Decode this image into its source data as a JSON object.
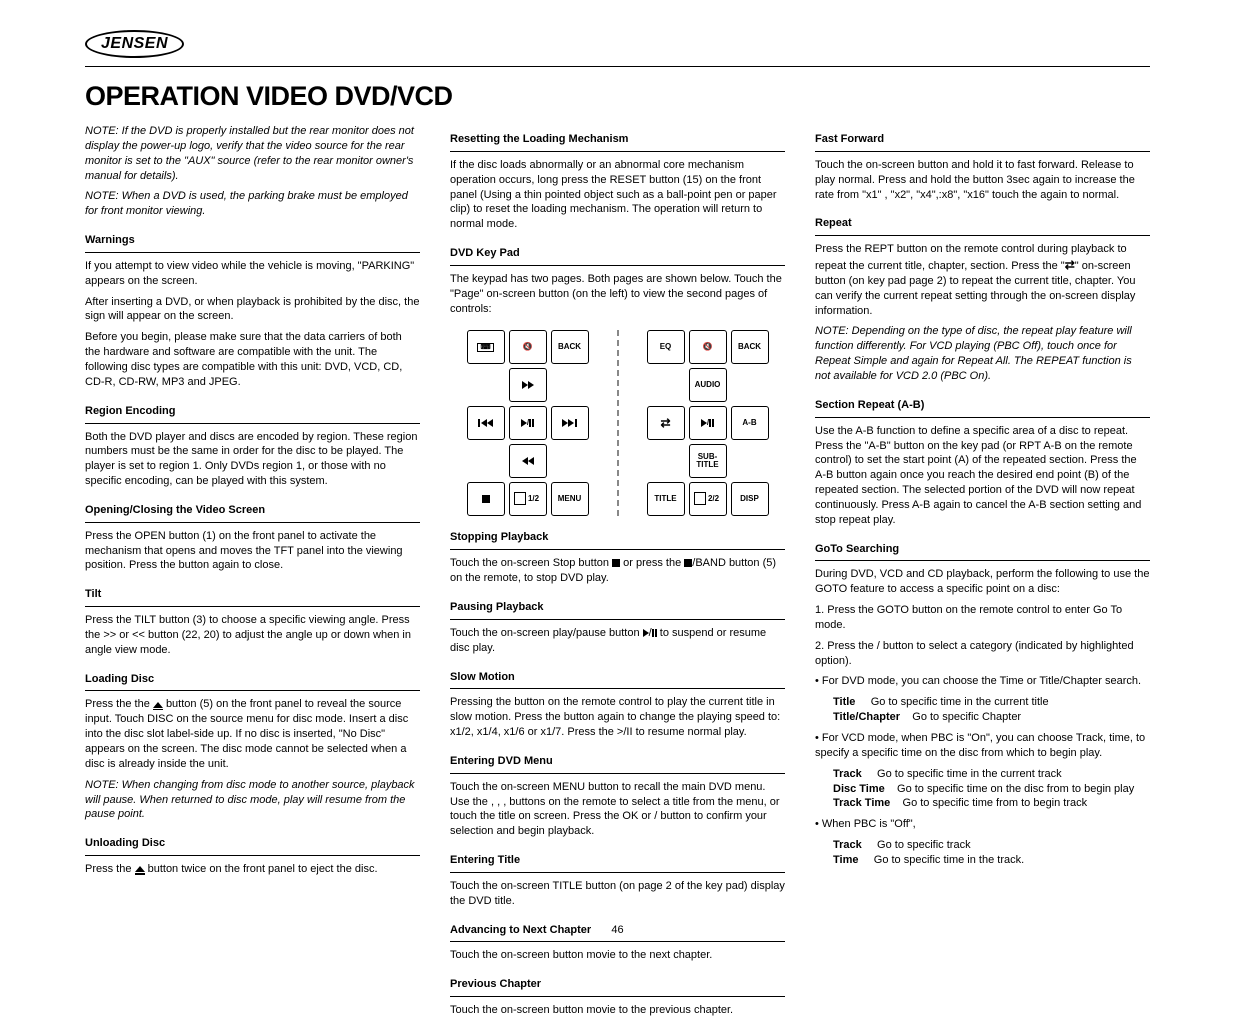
{
  "brand": "JENSEN",
  "title": "OPERATION VIDEO DVD/VCD",
  "footer": "46",
  "col1": {
    "note_h": "NOTE: If the DVD is properly installed but the rear monitor does not display the power-up logo, verify that the video source for the rear monitor is set to the \"AUX\" source (refer to the rear monitor owner's manual for details).",
    "note_p": "NOTE: When a DVD is used, the parking brake must be employed for front monitor viewing.",
    "s1_h": "Warnings",
    "s1_p1": "If you attempt to view video while the vehicle is moving, \"PARKING\" appears on the screen.",
    "s1_p2": "After inserting a DVD, or when playback is prohibited by the disc, the sign will appear on the screen.",
    "s1_p3": "Before you begin, please make sure that the data carriers of both the hardware and software are compatible with the unit. The following disc types are compatible with this unit: DVD, VCD, CD, CD-R, CD-RW, MP3 and JPEG.",
    "s2_h": "Region Encoding",
    "s2_p": "Both the DVD player and discs are encoded by region. These region numbers must be the same in order for the disc to be played. The player is set to region 1. Only DVDs region 1, or those with no specific encoding, can be played with this system.",
    "s3_h": "Opening/Closing the Video Screen",
    "s3_p": "Press the OPEN button (1) on the front panel to activate the mechanism that opens and moves the TFT panel into the viewing position. Press the button again to close.",
    "s4_h": "Tilt",
    "s4_p": "Press the TILT button (3) to choose a specific viewing angle. Press the >> or << button (22, 20) to adjust the angle up or down when in angle view mode.",
    "s5_h": "Loading Disc",
    "s5_p1": "Press the the      button (5) on the front panel to reveal the source input. Touch DISC on the source menu for disc mode. Insert a disc into the disc slot labelside up. If no disc is inserted, \"No Disc\" appears on the screen. The disc mode cannot be selected when a disc is already inside the unit.",
    "s5_p2": "NOTE: When changing from disc mode to another source, playback will pause. When returned to disc mode, play will resume from the pause point.",
    "s6_h": "Unloading Disc",
    "s6_p": "Press the      button twice on the front panel to eject the disc."
  },
  "col2": {
    "s1_h": "Resetting the Loading Mechanism",
    "s1_p": "If the disc loads abnormally or an abnormal core mechanism operation occurs, long press the RESET button (15) on the front panel (Using a thin pointed object such as a ball-point pen or paper clip) to reset the loading mechanism. The operation will return to normal mode.",
    "s2_h": "DVD Key Pad",
    "s2_p": "The keypad has two pages. Both pages are shown below. Touch the \"Page\" on-screen button (on the left) to view the second pages of controls:",
    "s3_h": "Stopping Playback",
    "s3_t1": "Touch the on-screen Stop button      or press the     /BAND button (5) on the remote, to stop DVD play.",
    "s4_h": "Pausing Playback",
    "s4_t1": "Touch the on-screen play/pause button     /     to suspend or resume disc play.",
    "s5_h": "Slow Motion",
    "s5_p": "Pressing the      button on the remote control to play the current title in slow motion. Press the button again to change the playing speed to: x1/2, x1/4, x1/6 or x1/7. Press the  >/II to resume normal play.",
    "s6_h": "Entering DVD Menu",
    "s6_p": "Touch the on-screen MENU button to recall the main DVD menu. Use the     ,    ,     ,     buttons on the remote to select a title from the menu, or touch the title on screen. Press the OK or       /     button to confirm your selection and begin playback.",
    "s7_h": "Entering Title",
    "s7_p": "Touch the on-screen TITLE button (on page 2 of the key pad) display the DVD title.",
    "s8_h": "Advancing to Next Chapter",
    "s8_p": "Touch the on-screen       button movie to the next chapter.",
    "s9_h": "Previous Chapter",
    "s9_p": "Touch the on-screen       button movie to the previous chapter."
  },
  "col3": {
    "s1_h": "Fast Forward",
    "s1_p": "Touch the on-screen       button and hold it to fast forward. Release  to play normal. Press and hold the button 3sec again to increase the rate from \"x1\" , \"x2\", \"x4\",:x8\", \"x16\" touch the       again to normal.",
    "s2_h": "Repeat",
    "s2_p1": "Press the REPT button on the remote control during playback to repeat the current title, chapter, section. Press the \"      \" on-screen button (on key pad page 2) to repeat the current title, chapter. You can verify the current repeat setting through the on-screen display information.",
    "s2_p2": "NOTE: Depending on the type of disc, the repeat play feature will function differently. For VCD playing (PBC Off), touch once for Repeat Simple and again for Repeat All. The REPEAT function is not available for VCD 2.0 (PBC On).",
    "s3_h": "Section Repeat (A-B)",
    "s3_p": "Use the A-B function to define a specific area of a disc to repeat. Press the \"A-B\" button on the key pad (or RPT A-B on the remote control) to set the start point (A) of the repeated section. Press the A-B button again once you reach the desired end point (B) of the repeated section. The selected portion of the DVD will now repeat continuously. Press A-B again to cancel the A-B section setting and stop repeat play.",
    "s4_h": "GoTo Searching",
    "s4_p1": "During DVD, VCD and CD playback, perform the following to use the GOTO feature to access a specific point on a disc:",
    "s4_li1": "1. Press the GOTO button on the remote control to enter Go To mode.",
    "s4_li2a": "2. Press the     /      button to select a category (indicated by highlighted option).",
    "s4_li2b": "• For DVD mode, you can choose the Time or Title/Chapter search.",
    "s4_tbl_th1": "Title",
    "s4_tbl_th2": "Go to specific time in the current title",
    "s4_tbl_r1a": "Title/Chapter",
    "s4_tbl_r1b": "Go to specific Chapter",
    "s4_li2c": "• For VCD mode, when PBC is \"On\", you can choose Track, time, to specify a specific time on the disc from which to begin play.",
    "s4_tbl2_a": "Track",
    "s4_tbl2_b": "Go to specific time in the current track",
    "s4_tbl2_c": "Disc Time",
    "s4_tbl2_d": "Go to specific time on the disc from to begin play",
    "s4_tbl2_e": "Track Time",
    "s4_tbl2_f": "Go to specific time from to begin track",
    "s4_li2d": "• When PBC is \"Off\",",
    "s4_tbl3_a": "Track",
    "s4_tbl3_b": "Go to specific track",
    "s4_tbl3_c": "Time",
    "s4_tbl3_d": "Go to specific time in the track."
  },
  "keypad": {
    "p1": {
      "r1c1": "kbd",
      "r1c2": "mute",
      "r1c3": "BACK",
      "r2c2": "ff",
      "r3c1": "prev",
      "r3c2": "playpause",
      "r3c3": "next",
      "r4c2": "rew",
      "r5c1": "stop",
      "r5c2_txt": "1/2",
      "r5c3": "MENU"
    },
    "p2": {
      "r1c1": "EQ",
      "r1c2": "mute",
      "r1c3": "BACK",
      "r2c2": "AUDIO",
      "r3c1": "swap",
      "r3c2": "playpause",
      "r3c3": "A-B",
      "r4c2": "SUB-\nTITLE",
      "r5c1": "TITLE",
      "r5c2_txt": "2/2",
      "r5c3": "DISP"
    }
  }
}
